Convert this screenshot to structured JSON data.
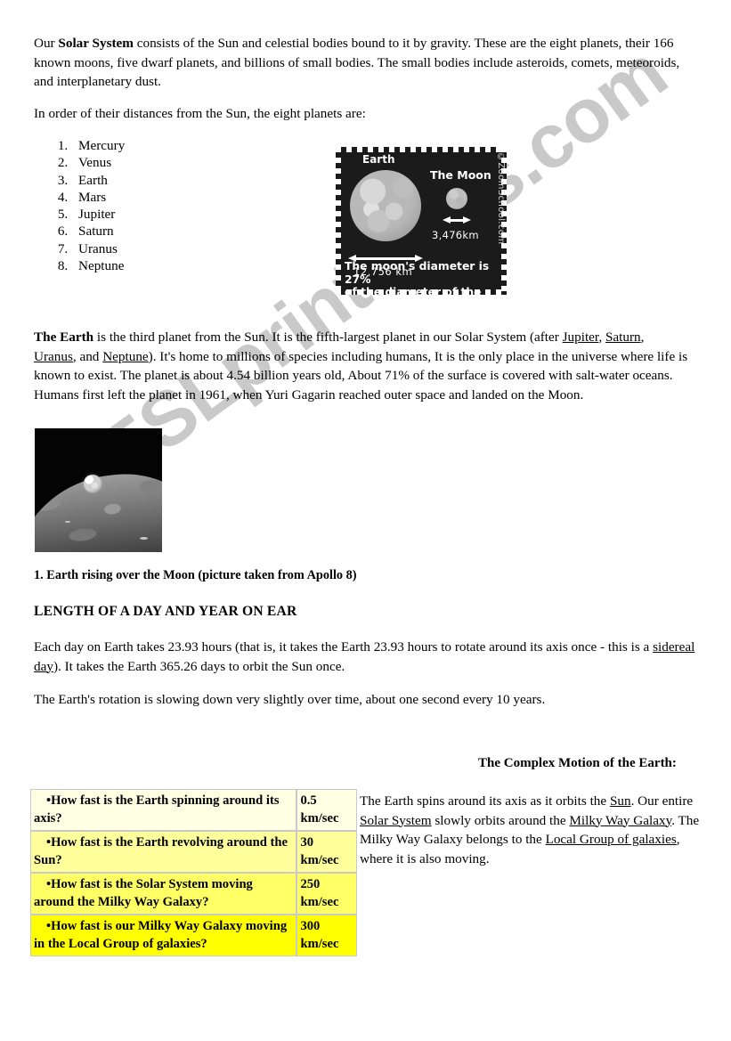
{
  "document": {
    "intro": {
      "lead_bold": "Solar System",
      "p1_before": "Our ",
      "p1_after": " consists of the Sun and celestial bodies bound to it by gravity. These are the eight planets, their 166 known moons, five dwarf planets, and billions of small bodies. The small bodies include asteroids, comets, meteoroids, and interplanetary dust.",
      "p2": "In order of their distances from the Sun, the eight planets are:"
    },
    "planets": [
      "Mercury",
      "Venus",
      "Earth",
      "Mars",
      "Jupiter",
      "Saturn",
      "Uranus",
      "Neptune"
    ],
    "stamp_figure": {
      "earth_label": "Earth",
      "moon_label": "The Moon",
      "earth_diameter": "12,756 km",
      "moon_diameter": "3,476km",
      "caption_line1": "The moon's diameter is 27%",
      "caption_line2": "of the diameter of  the Earth.",
      "credit": "©ZoomSchool.com"
    },
    "earth_paragraph": {
      "lead_bold": "The Earth",
      "t1": " is the third planet from the Sun. It is the fifth-largest planet in our Solar System (after ",
      "link1": "Jupiter",
      "t2": ", ",
      "link2": "Saturn",
      "t3": ", ",
      "link3": "Uranus",
      "t4": ", and ",
      "link4": "Neptune",
      "t5": "). It's home to millions of species including humans, It is the only place in the universe where life is known to exist. The planet is about 4.54 billion years old, About 71% of the surface is covered with salt-water oceans. Humans first left the planet in 1961, when Yuri Gagarin reached outer space and landed on the Moon."
    },
    "photo_caption": "1.  Earth rising over the Moon (picture taken from Apollo 8)",
    "section_heading": "LENGTH OF A DAY AND  YEAR ON EAR",
    "day_year": {
      "t1": "Each day on Earth takes 23.93 hours (that is, it takes the Earth 23.93 hours to rotate around its axis once - this is a ",
      "link1": "sidereal day",
      "t2": "). It takes the Earth 365.26 days to orbit the Sun once."
    },
    "rotation_note": "The Earth's rotation is slowing down very slightly over time, about one second every 10 years.",
    "motion_heading": "The Complex Motion of the Earth:",
    "motion_body": {
      "t1": " The Earth spins around its axis as it   orbits the ",
      "link1": "Sun",
      "t2": ". Our entire ",
      "link2": "Solar System",
      "t3": " slowly orbits around the ",
      "link3": "Milky Way Galaxy",
      "t4": ". The Milky Way Galaxy belongs to the ",
      "link4": "Local Group of galaxies",
      "t5": ", where it is also moving."
    },
    "speeds_table": {
      "rows": [
        {
          "question": "•How fast is the Earth spinning around its axis?",
          "value": "0.5\nkm/sec",
          "bg": "#ffffe4"
        },
        {
          "question": "•How fast is the Earth revolving around the Sun?",
          "value": "30\nkm/sec",
          "bg": "#ffff9c"
        },
        {
          "question": "•How fast is the Solar System moving around the Milky Way Galaxy?",
          "value": "250\nkm/sec",
          "bg": "#ffff66"
        },
        {
          "question": "•How fast is our Milky Way Galaxy moving in the Local Group of galaxies?",
          "value": "300\nkm/sec",
          "bg": "#ffff00"
        }
      ]
    },
    "watermark": "ESLprintables.com"
  }
}
